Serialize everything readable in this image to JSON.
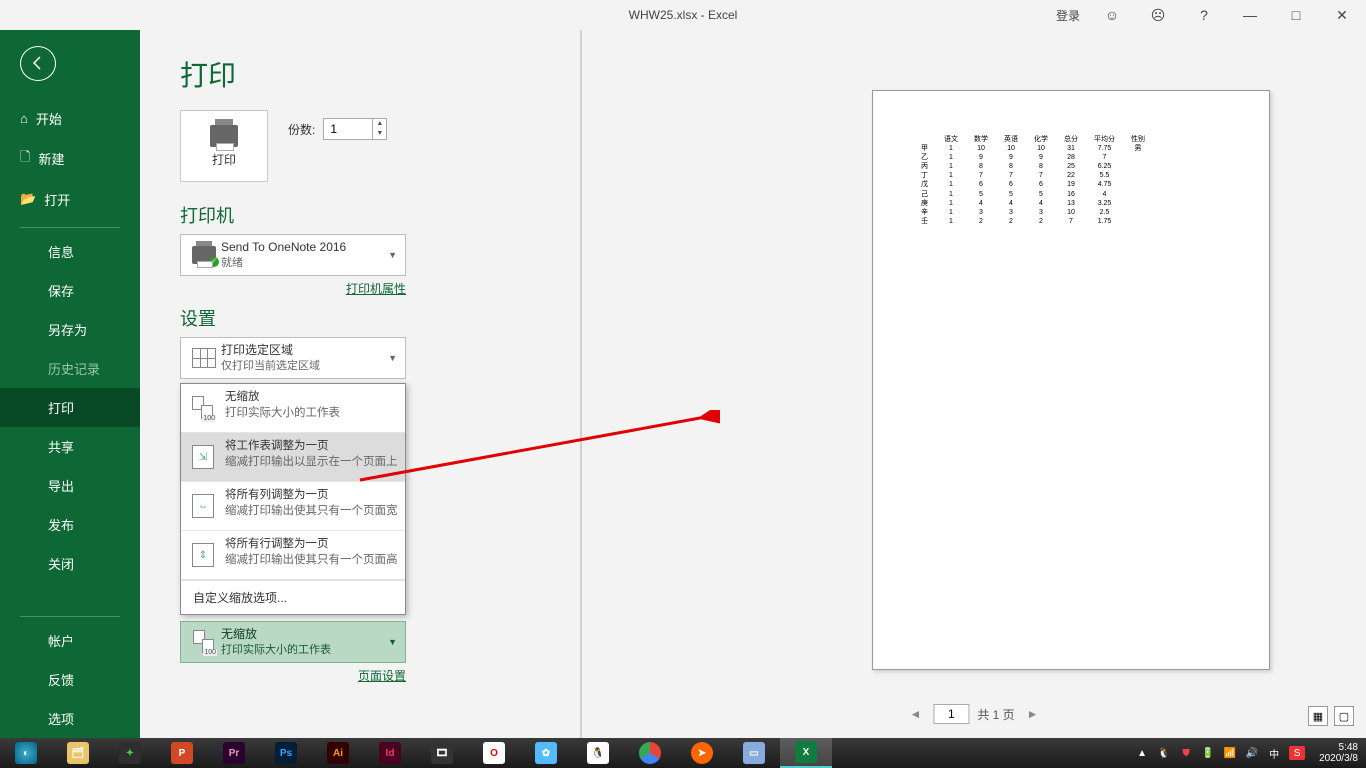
{
  "titlebar": {
    "title": "WHW25.xlsx - Excel",
    "login": "登录",
    "help": "?",
    "min": "—",
    "max": "□",
    "close": "✕"
  },
  "sidebar": {
    "home": "开始",
    "new": "新建",
    "open": "打开",
    "info": "信息",
    "save": "保存",
    "saveas": "另存为",
    "history": "历史记录",
    "print": "打印",
    "share": "共享",
    "export": "导出",
    "publish": "发布",
    "close": "关闭",
    "account": "帐户",
    "feedback": "反馈",
    "options": "选项"
  },
  "print": {
    "title": "打印",
    "btn_label": "打印",
    "copies_label": "份数:",
    "copies_value": "1",
    "printer_head": "打印机",
    "printer_name": "Send To OneNote 2016",
    "printer_status": "就绪",
    "printer_props": "打印机属性",
    "settings_head": "设置",
    "area_title": "打印选定区域",
    "area_sub": "仅打印当前选定区域",
    "page_setup": "页面设置"
  },
  "scaling": {
    "opt0_t": "无缩放",
    "opt0_s": "打印实际大小的工作表",
    "opt1_t": "将工作表调整为一页",
    "opt1_s": "缩减打印输出以显示在一个页面上",
    "opt2_t": "将所有列调整为一页",
    "opt2_s": "缩减打印输出使其只有一个页面宽",
    "opt3_t": "将所有行调整为一页",
    "opt3_s": "缩减打印输出使其只有一个页面高",
    "custom": "自定义缩放选项...",
    "display_t": "无缩放",
    "display_s": "打印实际大小的工作表",
    "pages_label": "100"
  },
  "pager": {
    "current": "1",
    "total_text": "共 1 页"
  },
  "chart_data": {
    "type": "table",
    "headers": [
      "",
      "语文",
      "数学",
      "英语",
      "化学",
      "总分",
      "平均分",
      "性别"
    ],
    "rows": [
      [
        "甲",
        "1",
        "10",
        "10",
        "10",
        "31",
        "7.75",
        "男"
      ],
      [
        "乙",
        "1",
        "9",
        "9",
        "9",
        "28",
        "7",
        ""
      ],
      [
        "丙",
        "1",
        "8",
        "8",
        "8",
        "25",
        "6.25",
        ""
      ],
      [
        "丁",
        "1",
        "7",
        "7",
        "7",
        "22",
        "5.5",
        ""
      ],
      [
        "戊",
        "1",
        "6",
        "6",
        "6",
        "19",
        "4.75",
        ""
      ],
      [
        "己",
        "1",
        "5",
        "5",
        "5",
        "16",
        "4",
        ""
      ],
      [
        "庚",
        "1",
        "4",
        "4",
        "4",
        "13",
        "3.25",
        ""
      ],
      [
        "辛",
        "1",
        "3",
        "3",
        "3",
        "10",
        "2.5",
        ""
      ],
      [
        "壬",
        "1",
        "2",
        "2",
        "2",
        "7",
        "1.75",
        ""
      ]
    ]
  },
  "taskbar": {
    "time": "5:48",
    "date": "2020/3/8",
    "ime": "中",
    "tray_up": "▲"
  }
}
